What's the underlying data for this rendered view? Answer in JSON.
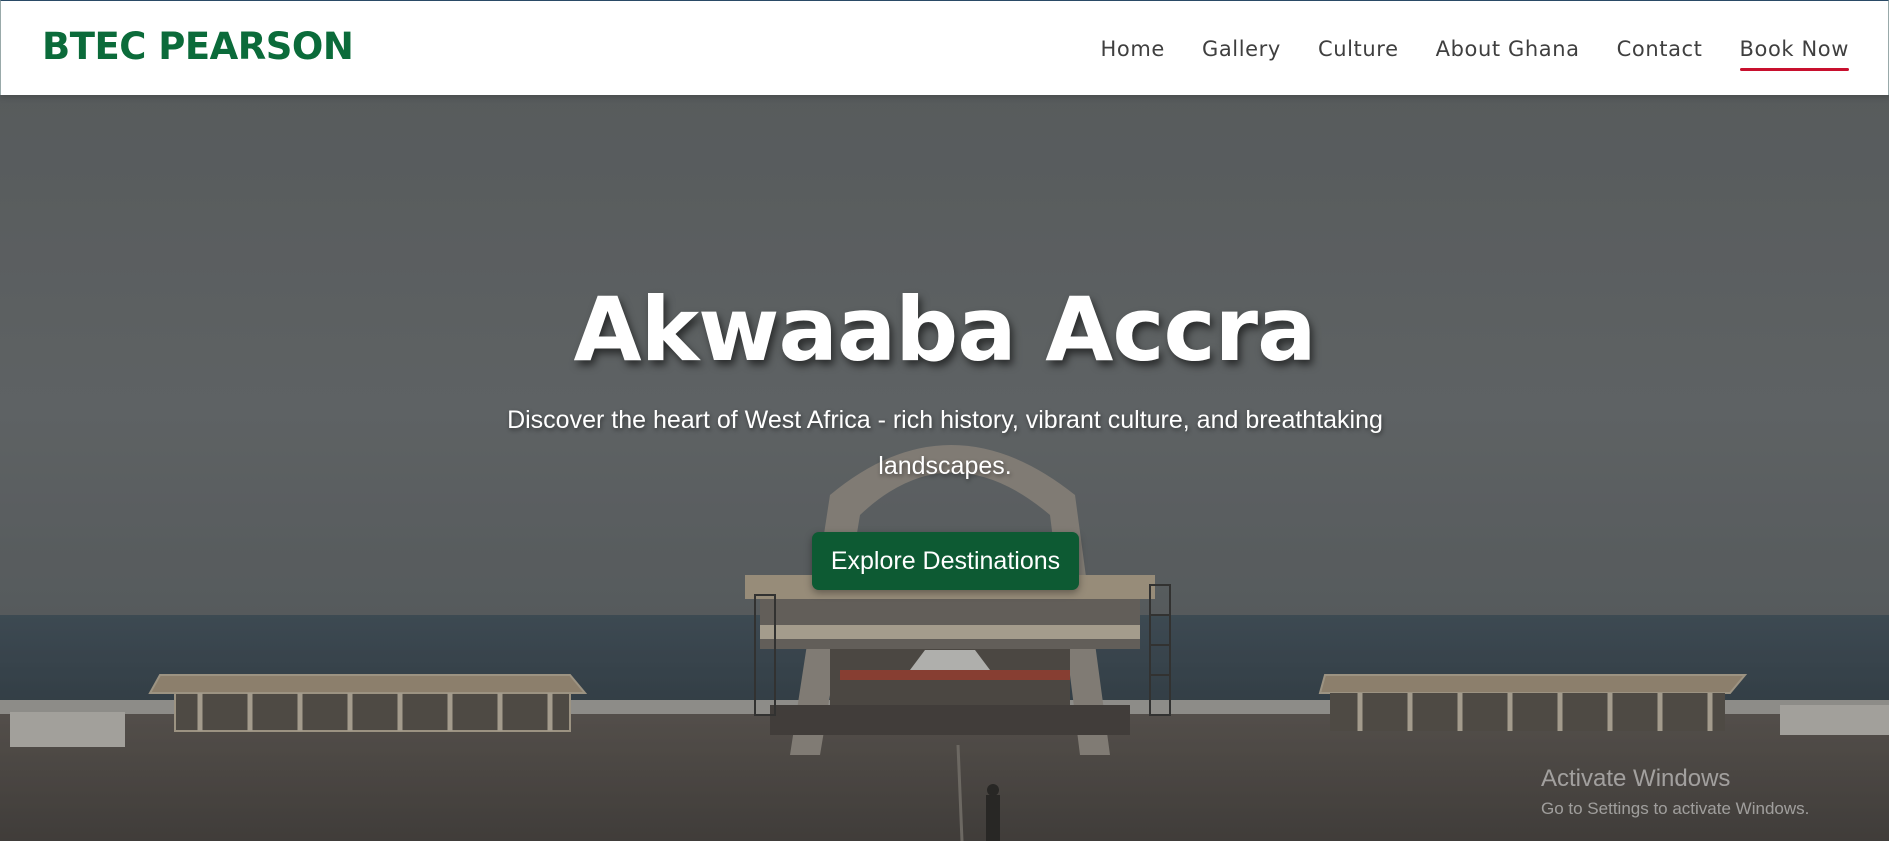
{
  "brand": {
    "name": "BTEC PEARSON",
    "color": "#0b6b3a"
  },
  "nav": {
    "items": [
      {
        "label": "Home"
      },
      {
        "label": "Gallery"
      },
      {
        "label": "Culture"
      },
      {
        "label": "About Ghana"
      },
      {
        "label": "Contact"
      },
      {
        "label": "Book Now",
        "active": true
      }
    ],
    "active_underline_color": "#c8102e"
  },
  "hero": {
    "title": "Akwaaba Accra",
    "subtitle": "Discover the heart of West Africa - rich history, vibrant culture, and breathtaking landscapes.",
    "cta_label": "Explore Destinations",
    "cta_color": "#0d5a33",
    "background_image": "black-star-square-arch-photo"
  },
  "os_watermark": {
    "title": "Activate Windows",
    "subtitle": "Go to Settings to activate Windows."
  }
}
